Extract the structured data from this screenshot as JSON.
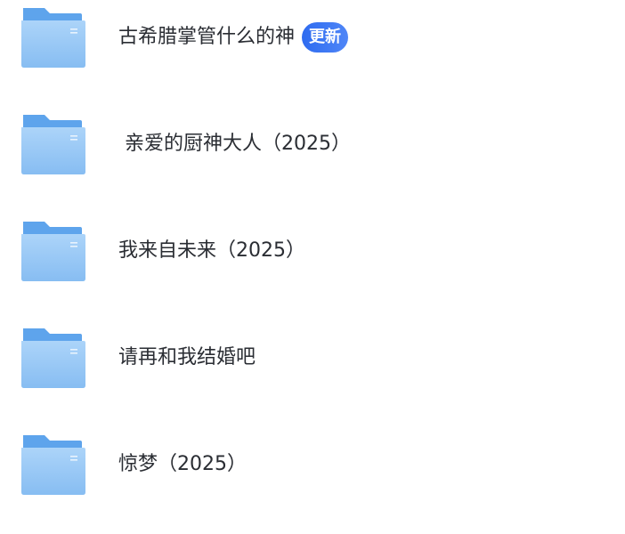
{
  "folders": [
    {
      "name": "古希腊掌管什么的神",
      "badge": "更新"
    },
    {
      "name": " 亲爱的厨神大人（2025）"
    },
    {
      "name": "我来自未来（2025）"
    },
    {
      "name": "请再和我结婚吧"
    },
    {
      "name": "惊梦（2025）"
    }
  ],
  "icon": "folder-icon",
  "colors": {
    "folder_tab": "#5fa6ec",
    "folder_front_top": "#a9d2f8",
    "folder_front_bottom": "#85bbf1",
    "badge": "#3b74f2",
    "text": "#2a2d33"
  }
}
